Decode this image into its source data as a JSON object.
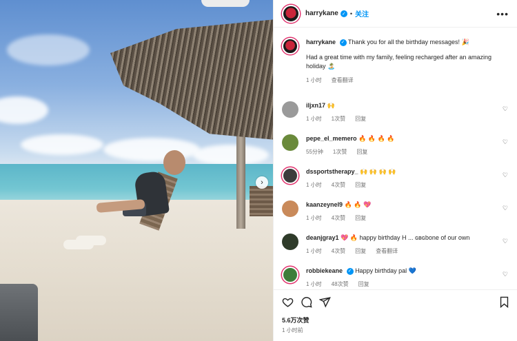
{
  "post": {
    "username": "harrykane",
    "follow_label": "关注",
    "dot": "•",
    "more_icon": "ellipsis-icon",
    "carousel_next": "›"
  },
  "caption": {
    "username": "harrykane",
    "text": "Thank you for all the birthday messages! 🎉",
    "extra": "Had a great time with my family, feeling recharged after an amazing holiday 🏝️",
    "time": "1 小时",
    "translate": "查看翻译"
  },
  "comments": [
    {
      "username": "iljxn17",
      "text": "🙌",
      "time": "1 小时",
      "likes": "1次赞",
      "reply": "回复",
      "avatar_color": "#9a9a9a",
      "ring": false
    },
    {
      "username": "pepe_el_memero",
      "text": "🔥 🔥 🔥 🔥",
      "time": "55分钟",
      "likes": "1次赞",
      "reply": "回复",
      "avatar_color": "#6a8a3b",
      "ring": false
    },
    {
      "username": "dssportstherapy_",
      "text": "🙌 🙌 🙌 🙌",
      "time": "1 小时",
      "likes": "4次赞",
      "reply": "回复",
      "avatar_color": "#3c3c3c",
      "ring": true
    },
    {
      "username": "kaanzeynel9",
      "text": "🔥 🔥 💖",
      "time": "1 小时",
      "likes": "4次赞",
      "reply": "回复",
      "avatar_color": "#c98a5a",
      "ring": false
    },
    {
      "username": "deanjgray1",
      "text": "💖 🔥 happy birthday H ... ɢʙɢbone of our own",
      "time": "1 小时",
      "likes": "4次赞",
      "reply": "回复",
      "translate": "查看翻译",
      "avatar_color": "#2f3b2a",
      "ring": false
    },
    {
      "username": "robbiekeane",
      "text": "Happy birthday pal 💙",
      "time": "1 小时",
      "likes": "48次赞",
      "reply": "回复",
      "avatar_color": "#3f7d3a",
      "ring": true,
      "verified": true
    }
  ],
  "footer": {
    "likes": "5.6万次赞",
    "time": "1 小时前"
  },
  "icons": {
    "heart": "heart-icon",
    "comment": "comment-icon",
    "share": "share-icon",
    "save": "bookmark-icon"
  }
}
